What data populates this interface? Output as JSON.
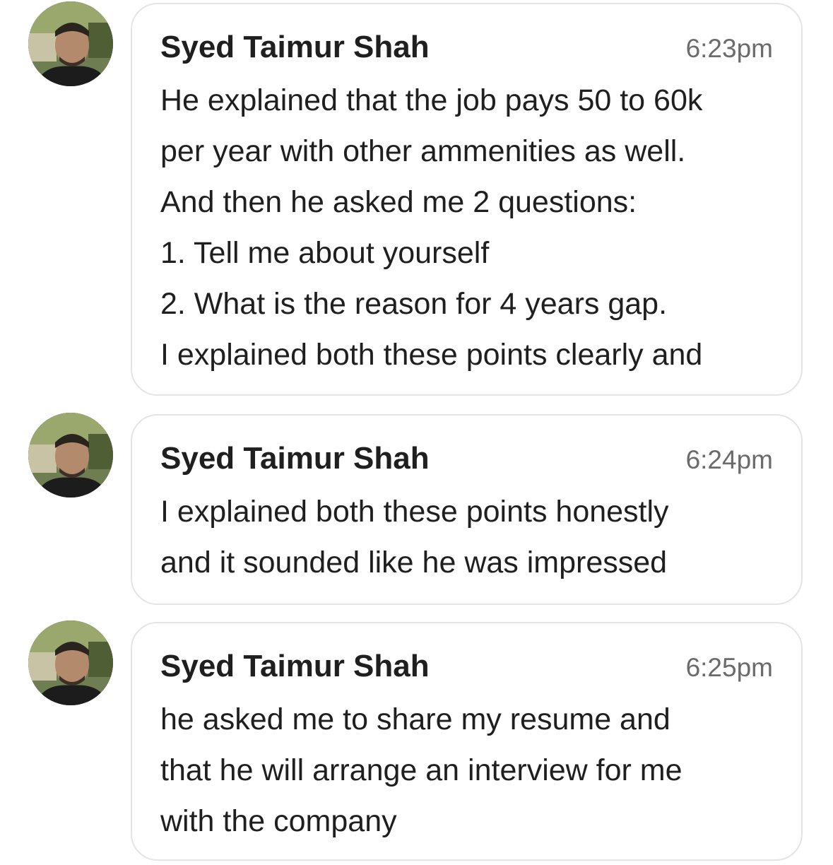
{
  "colors": {
    "bubble_border": "#e4e4e4",
    "text": "#1f1f1f",
    "timestamp": "#6b6b6b"
  },
  "messages": [
    {
      "avatar_icon": "user-avatar-photo",
      "sender": "Syed Taimur Shah",
      "time": "6:23pm",
      "lines": [
        "He explained that the job pays 50 to 60k",
        "per year with other ammenities as well.",
        "And then he asked me 2 questions:",
        "1. Tell me about yourself",
        "2. What is the reason for 4 years gap.",
        "I explained both these points clearly and"
      ]
    },
    {
      "avatar_icon": "user-avatar-photo",
      "sender": "Syed Taimur Shah",
      "time": "6:24pm",
      "lines": [
        "I explained both these points honestly",
        "and it sounded like he was impressed"
      ]
    },
    {
      "avatar_icon": "user-avatar-photo",
      "sender": "Syed Taimur Shah",
      "time": "6:25pm",
      "lines": [
        "he asked me to share my resume and",
        "that he will arrange an interview for me",
        "with the company"
      ]
    }
  ]
}
